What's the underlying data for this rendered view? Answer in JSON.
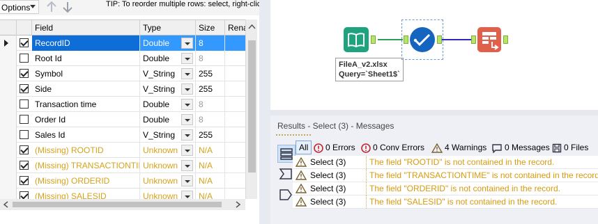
{
  "toolbar": {
    "options_label": "Options",
    "tip": "TIP: To reorder multiple rows: select, right-click"
  },
  "grid": {
    "columns": [
      "Field",
      "Type",
      "Size",
      "Rena"
    ],
    "rows": [
      {
        "checked": true,
        "field": "RecordID",
        "type": "Double",
        "size": "8",
        "selected": true,
        "missing": false,
        "size_grey": true
      },
      {
        "checked": false,
        "field": "Root Id",
        "type": "Double",
        "size": "8",
        "selected": false,
        "missing": false,
        "size_grey": true
      },
      {
        "checked": true,
        "field": "Symbol",
        "type": "V_String",
        "size": "255",
        "selected": false,
        "missing": false,
        "size_grey": false
      },
      {
        "checked": true,
        "field": "Side",
        "type": "V_String",
        "size": "255",
        "selected": false,
        "missing": false,
        "size_grey": false
      },
      {
        "checked": false,
        "field": "Transaction time",
        "type": "Double",
        "size": "8",
        "selected": false,
        "missing": false,
        "size_grey": true
      },
      {
        "checked": false,
        "field": "Order Id",
        "type": "Double",
        "size": "8",
        "selected": false,
        "missing": false,
        "size_grey": true
      },
      {
        "checked": false,
        "field": "Sales Id",
        "type": "V_String",
        "size": "255",
        "selected": false,
        "missing": false,
        "size_grey": false
      },
      {
        "checked": true,
        "field": "(Missing) ROOTID",
        "type": "Unknown",
        "size": "N/A",
        "selected": false,
        "missing": true,
        "size_grey": false
      },
      {
        "checked": true,
        "field": "(Missing) TRANSACTIONTIME",
        "type": "Unknown",
        "size": "N/A",
        "selected": false,
        "missing": true,
        "size_grey": false
      },
      {
        "checked": true,
        "field": "(Missing) ORDERID",
        "type": "Unknown",
        "size": "N/A",
        "selected": false,
        "missing": true,
        "size_grey": false
      },
      {
        "checked": true,
        "field": "(Missing) SALESID",
        "type": "Unknown",
        "size": "N/A",
        "selected": false,
        "missing": true,
        "size_grey": false
      }
    ]
  },
  "canvas": {
    "annotation_line1": "FileA_v2.xlsx",
    "annotation_line2": "Query=`Sheet1$`"
  },
  "results": {
    "title": "Results - Select (3) - Messages",
    "filters": {
      "all": "All",
      "errors": "0 Errors",
      "conv_errors": "0 Conv Errors",
      "warnings": "4 Warnings",
      "messages": "0 Messages",
      "files": "0 Files"
    },
    "messages": [
      {
        "tool": "Select (3)",
        "text": "The field \"ROOTID\" is not contained in the record."
      },
      {
        "tool": "Select (3)",
        "text": "The field \"TRANSACTIONTIME\" is not contained in the record."
      },
      {
        "tool": "Select (3)",
        "text": "The field \"ORDERID\" is not contained in the record."
      },
      {
        "tool": "Select (3)",
        "text": "The field \"SALESID\" is not contained in the record."
      }
    ]
  },
  "colors": {
    "selection": "#3399ff",
    "missing_text": "#d6a21c",
    "warning_text": "#d69a10",
    "input_tool": "#1fa37f",
    "select_tool": "#1565c0",
    "output_tool": "#e0604b"
  },
  "icons": {
    "input_tool": "book-icon",
    "select_tool": "checkmark-icon",
    "output_tool": "browse-table-icon",
    "error": "error-circle-icon",
    "warning": "warning-triangle-icon",
    "message": "speech-bubble-icon",
    "file": "floppy-disk-icon"
  }
}
